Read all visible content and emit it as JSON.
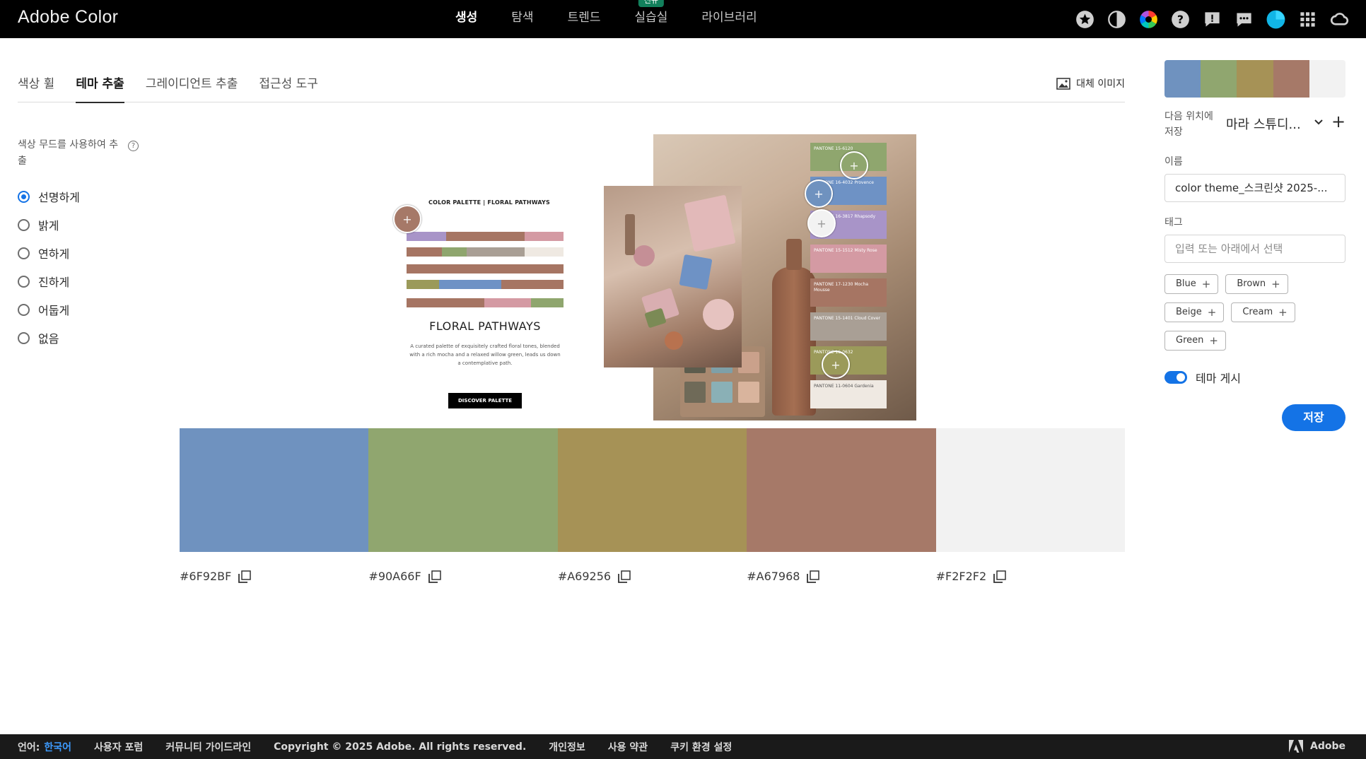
{
  "app": {
    "title": "Adobe Color"
  },
  "nav": [
    {
      "label": "생성",
      "active": true
    },
    {
      "label": "탐색"
    },
    {
      "label": "트렌드"
    },
    {
      "label": "실습실",
      "badge": "신규"
    },
    {
      "label": "라이브러리"
    }
  ],
  "top_icons": [
    "star-icon",
    "contrast-icon",
    "color-wheel-icon",
    "help-icon",
    "feedback-icon",
    "chat-icon",
    "avatar-icon",
    "apps-grid-icon",
    "creative-cloud-icon"
  ],
  "tabs": [
    {
      "label": "색상 휠"
    },
    {
      "label": "테마 추출",
      "active": true
    },
    {
      "label": "그레이디언트 추출"
    },
    {
      "label": "접근성 도구"
    }
  ],
  "alt_image_label": "대체 이미지",
  "mood": {
    "label": "색상 무드를 사용하여 추출",
    "help": "?",
    "options": [
      {
        "label": "선명하게",
        "checked": true
      },
      {
        "label": "밝게"
      },
      {
        "label": "연하게"
      },
      {
        "label": "진하게"
      },
      {
        "label": "어둡게"
      },
      {
        "label": "없음"
      }
    ]
  },
  "flyer": {
    "title": "COLOR PALETTE | FLORAL PATHWAYS",
    "heading": "FLORAL PATHWAYS",
    "body": "A curated palette of exquisitely crafted floral tones, blended with a rich mocha and a relaxed willow green, leads us down a contemplative path.",
    "button": "DISCOVER PALETTE"
  },
  "photo_cards": [
    {
      "text": "PANTONE 15-6120",
      "color": "#8fa66e"
    },
    {
      "text": "PANTONE 16-4032 Provence Blue",
      "color": "#6e92c5"
    },
    {
      "text": "PANTONE 16-3817 Rhapsody",
      "color": "#a894c8"
    },
    {
      "text": "PANTONE 15-1512 Misty Rose",
      "color": "#d49aa3"
    },
    {
      "text": "PANTONE 17-1230 Mocha Mousse",
      "color": "#a67563"
    },
    {
      "text": "PANTONE 15-1401 Cloud Cover",
      "color": "#a99f95"
    },
    {
      "text": "PANTONE 16-0632",
      "color": "#9b9a5a"
    },
    {
      "text": "PANTONE 11-0604 Gardenia",
      "color": "#efe9e2"
    }
  ],
  "swatches": [
    {
      "hex": "#6F92BF",
      "color": "#6F92BF"
    },
    {
      "hex": "#90A66F",
      "color": "#90A66F"
    },
    {
      "hex": "#A69256",
      "color": "#A69256"
    },
    {
      "hex": "#A67968",
      "color": "#A67968"
    },
    {
      "hex": "#F2F2F2",
      "color": "#F2F2F2"
    }
  ],
  "right_panel": {
    "save_to_label": "다음 위치에 저장",
    "library": "마라 스튜디...",
    "name_label": "이름",
    "name_value": "color theme_스크린샷 2025-...",
    "tags_label": "태그",
    "tags_placeholder": "입력 또는 아래에서 선택",
    "suggested_tags": [
      "Blue",
      "Brown",
      "Beige",
      "Cream",
      "Green"
    ],
    "publish_label": "테마 게시",
    "publish_on": true,
    "save_button": "저장"
  },
  "footer": {
    "lang_label": "언어:",
    "lang_value": "한국어",
    "links": [
      "사용자 포럼",
      "커뮤니티 가이드라인",
      "Copyright © 2025 Adobe. All rights reserved.",
      "개인정보",
      "사용 약관",
      "쿠키 환경 설정"
    ],
    "brand": "Adobe"
  }
}
